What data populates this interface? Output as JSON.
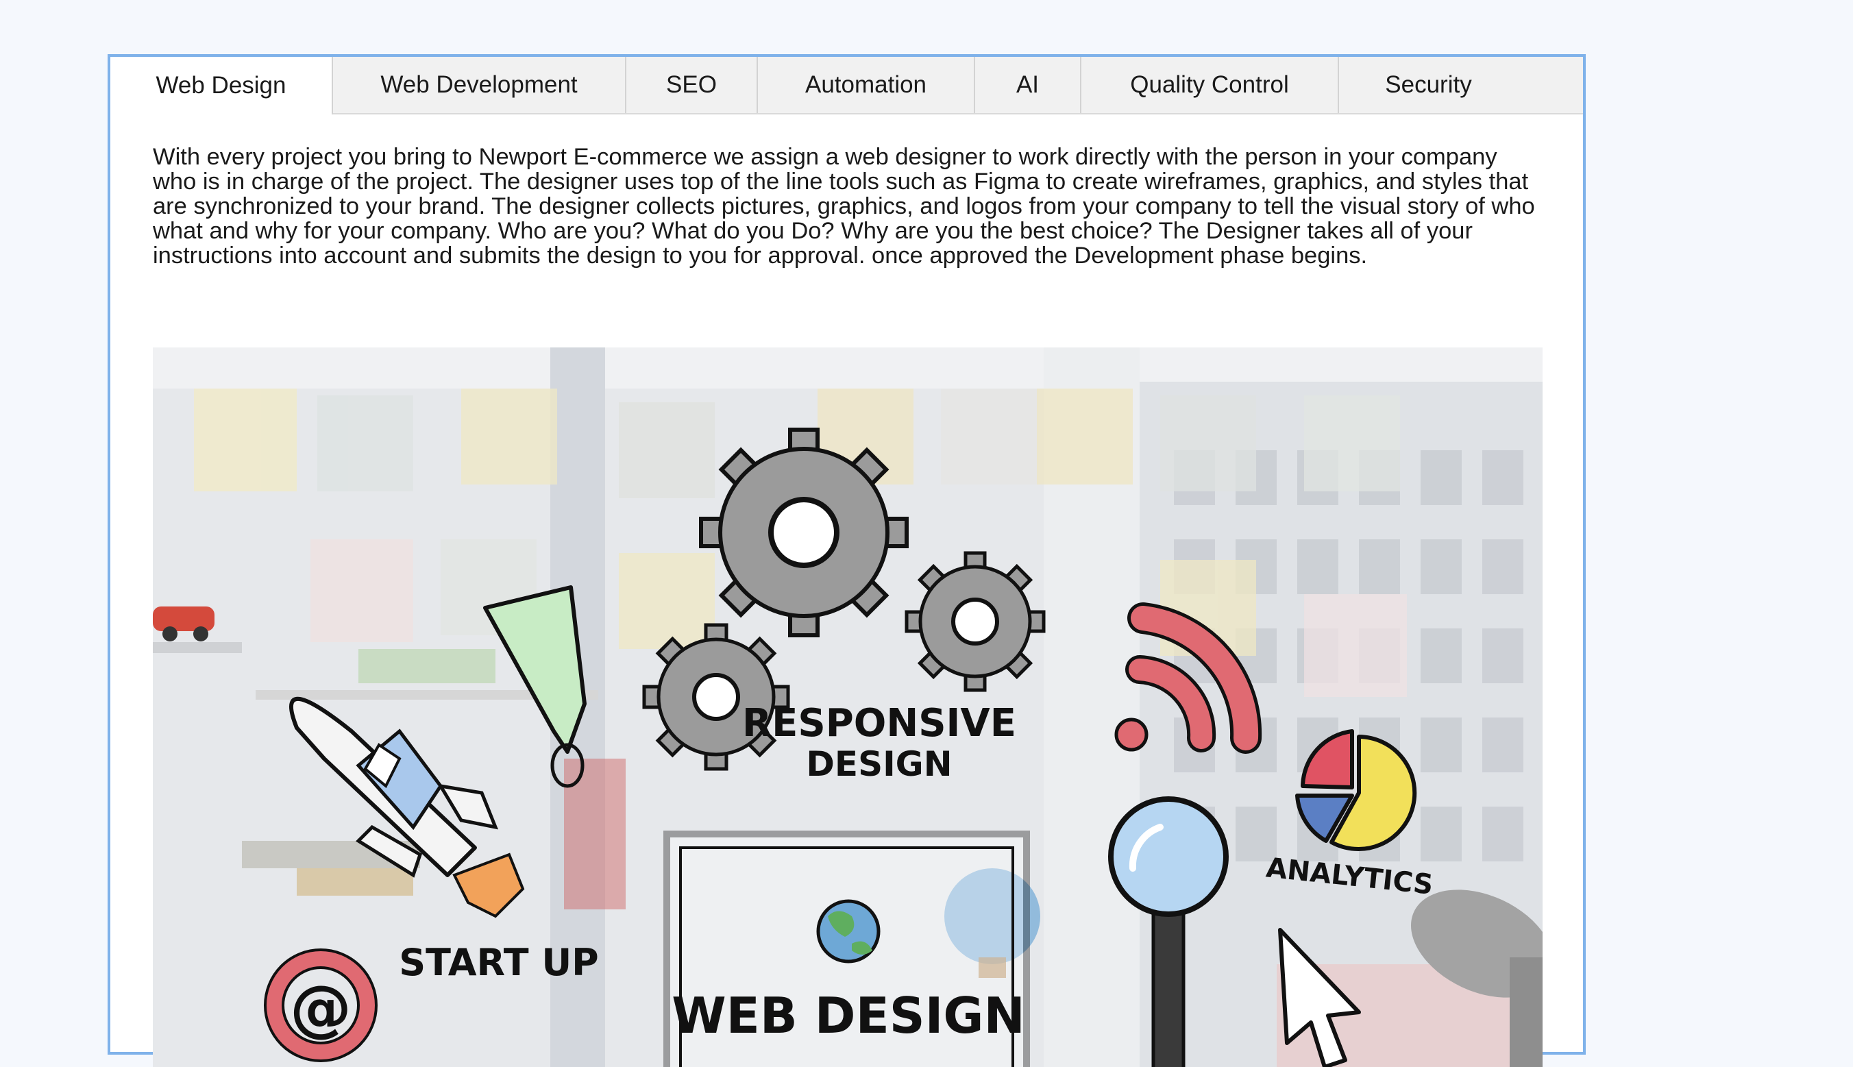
{
  "tabs": [
    {
      "label": "Web Design",
      "active": true
    },
    {
      "label": "Web Development",
      "active": false
    },
    {
      "label": "SEO",
      "active": false
    },
    {
      "label": "Automation",
      "active": false
    },
    {
      "label": "AI",
      "active": false
    },
    {
      "label": "Quality Control",
      "active": false
    },
    {
      "label": "Security",
      "active": false
    }
  ],
  "content": {
    "description": "With every project you bring to Newport E-commerce we assign a web designer to work directly with the person in your company who is in charge of the project. The designer uses top of the line tools such as Figma to create wireframes, graphics, and styles that are synchronized to your brand. The designer collects pictures, graphics, and logos from your company to tell the visual story of who what and why for your company. Who are you? What do you Do? Why are you the best choice? The Designer takes all of your instructions into account and submits the design to you for approval. once approved the Development phase begins."
  },
  "illustration": {
    "labels": {
      "responsive_line1": "RESPONSIVE",
      "responsive_line2": "DESIGN",
      "analytics": "ANALYTICS",
      "start_up": "START UP",
      "web_design": "WEB DESIGN",
      "at_sign": "@"
    },
    "colors": {
      "gear": "#9b9b9b",
      "rss": "#e06a72",
      "pie_red": "#e05363",
      "pie_yellow": "#f2e05a",
      "pie_blue": "#5b7fc4",
      "bubble": "#c8ecc5",
      "magnifier_glass": "#b6d6f2",
      "rocket_body": "#f4f4f4",
      "rocket_window": "#a9c8ec",
      "flame": "#f2a25a",
      "at_sign": "#e06a72"
    }
  }
}
